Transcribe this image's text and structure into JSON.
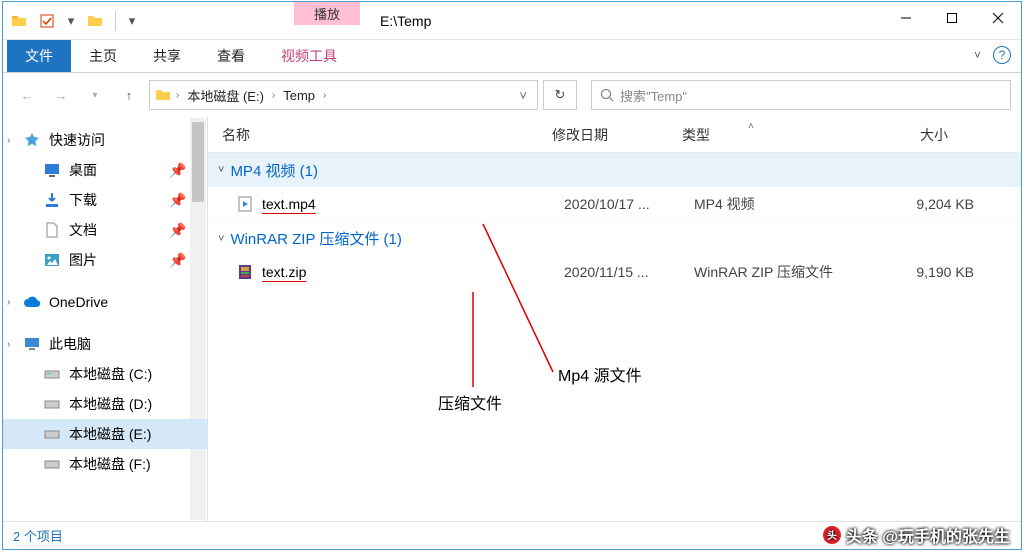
{
  "title_path": "E:\\Temp",
  "ribbon_context": "播放",
  "tabs": {
    "file": "文件",
    "home": "主页",
    "share": "共享",
    "view": "查看",
    "ctx": "视频工具"
  },
  "nav": {
    "crumb_drive": "本地磁盘 (E:)",
    "crumb_folder": "Temp"
  },
  "search_placeholder": "搜索\"Temp\"",
  "sidebar": {
    "quick": "快速访问",
    "desktop": "桌面",
    "downloads": "下载",
    "documents": "文档",
    "pictures": "图片",
    "onedrive": "OneDrive",
    "thispc": "此电脑",
    "drive_c": "本地磁盘 (C:)",
    "drive_d": "本地磁盘 (D:)",
    "drive_e": "本地磁盘 (E:)",
    "drive_f": "本地磁盘 (F:)"
  },
  "columns": {
    "name": "名称",
    "date": "修改日期",
    "type": "类型",
    "size": "大小"
  },
  "groups": [
    {
      "label": "MP4 视频 (1)",
      "files": [
        {
          "name": "text.mp4",
          "date": "2020/10/17 ...",
          "type": "MP4 视频",
          "size": "9,204 KB"
        }
      ]
    },
    {
      "label": "WinRAR ZIP 压缩文件 (1)",
      "files": [
        {
          "name": "text.zip",
          "date": "2020/11/15 ...",
          "type": "WinRAR ZIP 压缩文件",
          "size": "9,190 KB"
        }
      ]
    }
  ],
  "status": "2 个项目",
  "annotations": {
    "a1": "Mp4 源文件",
    "a2": "压缩文件"
  },
  "watermark": "头条 @玩手机的张先生"
}
